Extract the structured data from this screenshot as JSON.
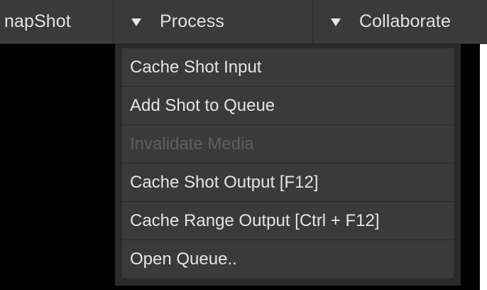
{
  "tabs": [
    {
      "label": "napShot",
      "has_arrow": false
    },
    {
      "label": "Process",
      "has_arrow": true,
      "icon": "triangle-down-icon"
    },
    {
      "label": "Collaborate",
      "has_arrow": true,
      "icon": "triangle-down-icon"
    }
  ],
  "menu": {
    "items": [
      {
        "label": "Cache Shot Input",
        "enabled": true
      },
      {
        "label": "Add Shot to Queue",
        "enabled": true
      },
      {
        "label": "Invalidate Media",
        "enabled": false
      },
      {
        "label": "Cache Shot Output [F12]",
        "enabled": true
      },
      {
        "label": "Cache Range Output [Ctrl + F12]",
        "enabled": true
      },
      {
        "label": "Open Queue..",
        "enabled": true
      }
    ]
  },
  "colors": {
    "bar_bg": "#3a3a3a",
    "menu_bg": "#2b2b2b",
    "item_bg": "#3a3a3a",
    "text": "#e4e4e4",
    "disabled_text": "#5e5e5e",
    "viewport": "#000000"
  }
}
